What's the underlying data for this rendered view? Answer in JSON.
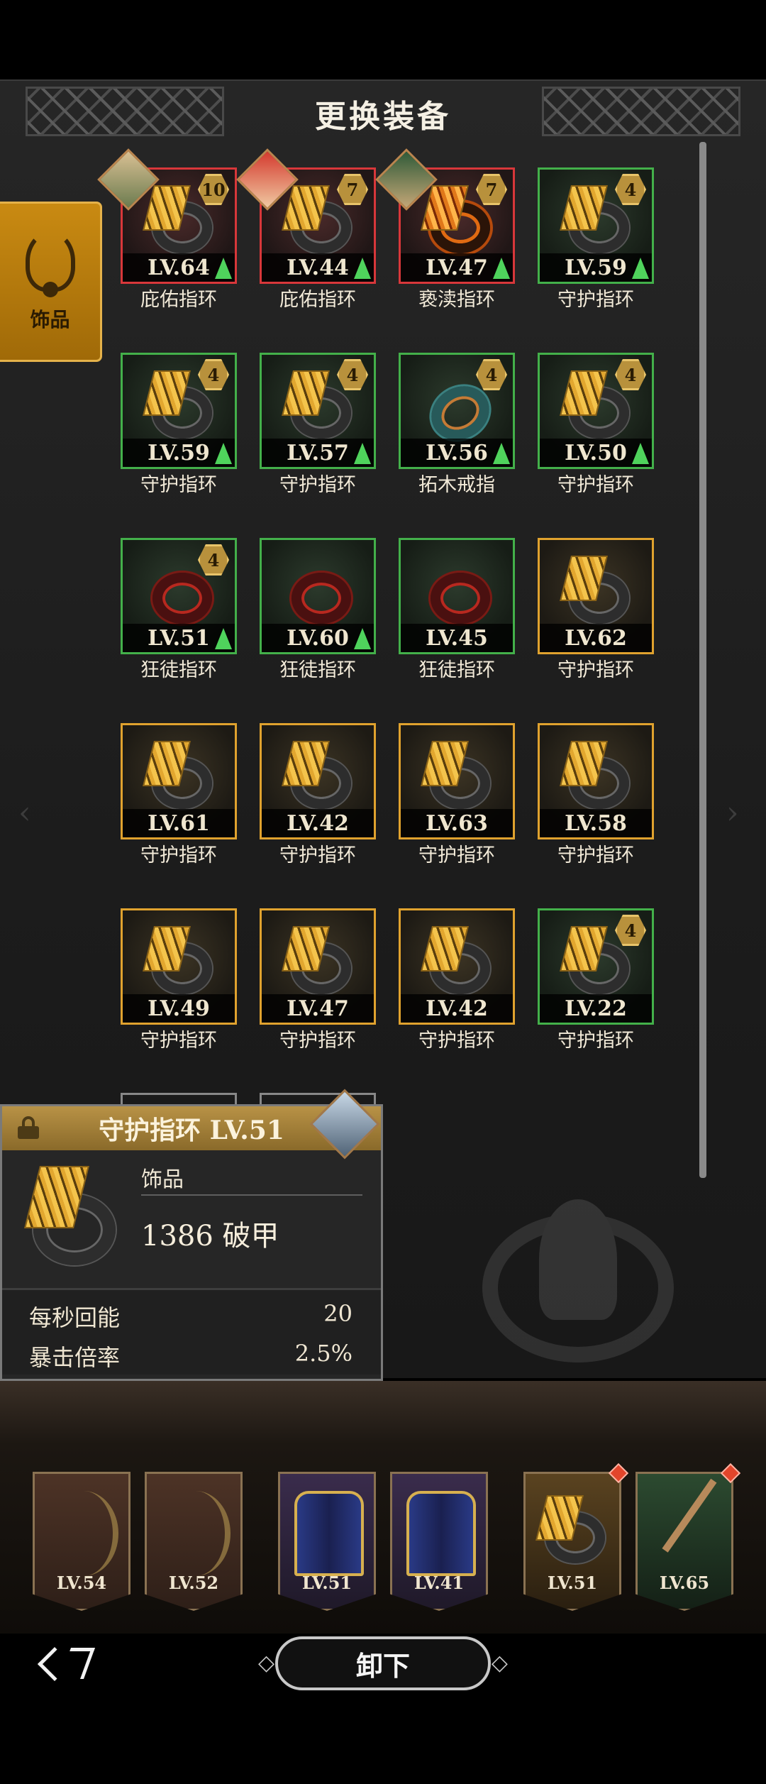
{
  "header": {
    "title": "更换装备"
  },
  "side_tab": {
    "label": "饰品"
  },
  "items": [
    {
      "level": "LV.64",
      "name": "庇佑指环",
      "rarity": "red",
      "badge": "10",
      "up": true,
      "avatar": "a1",
      "ring": "gold"
    },
    {
      "level": "LV.44",
      "name": "庇佑指环",
      "rarity": "red",
      "badge": "7",
      "up": true,
      "avatar": "a2",
      "ring": "gold"
    },
    {
      "level": "LV.47",
      "name": "亵渎指环",
      "rarity": "red",
      "badge": "7",
      "up": true,
      "avatar": "a3",
      "ring": "fire"
    },
    {
      "level": "LV.59",
      "name": "守护指环",
      "rarity": "green",
      "badge": "4",
      "up": true,
      "avatar": null,
      "ring": "gold"
    },
    {
      "level": "LV.59",
      "name": "守护指环",
      "rarity": "green",
      "badge": "4",
      "up": true,
      "avatar": null,
      "ring": "gold"
    },
    {
      "level": "LV.57",
      "name": "守护指环",
      "rarity": "green",
      "badge": "4",
      "up": true,
      "avatar": null,
      "ring": "gold"
    },
    {
      "level": "LV.56",
      "name": "拓木戒指",
      "rarity": "green",
      "badge": "4",
      "up": true,
      "avatar": null,
      "ring": "teal"
    },
    {
      "level": "LV.50",
      "name": "守护指环",
      "rarity": "green",
      "badge": "4",
      "up": true,
      "avatar": null,
      "ring": "gold"
    },
    {
      "level": "LV.51",
      "name": "狂徒指环",
      "rarity": "green",
      "badge": "4",
      "up": true,
      "avatar": null,
      "ring": "red"
    },
    {
      "level": "LV.60",
      "name": "狂徒指环",
      "rarity": "green",
      "badge": null,
      "up": true,
      "avatar": null,
      "ring": "red"
    },
    {
      "level": "LV.45",
      "name": "狂徒指环",
      "rarity": "green",
      "badge": null,
      "up": false,
      "avatar": null,
      "ring": "red"
    },
    {
      "level": "LV.62",
      "name": "守护指环",
      "rarity": "gold",
      "badge": null,
      "up": false,
      "avatar": null,
      "ring": "gold"
    },
    {
      "level": "LV.61",
      "name": "守护指环",
      "rarity": "gold",
      "badge": null,
      "up": false,
      "avatar": null,
      "ring": "gold"
    },
    {
      "level": "LV.42",
      "name": "守护指环",
      "rarity": "gold",
      "badge": null,
      "up": false,
      "avatar": null,
      "ring": "gold"
    },
    {
      "level": "LV.63",
      "name": "守护指环",
      "rarity": "gold",
      "badge": null,
      "up": false,
      "avatar": null,
      "ring": "gold"
    },
    {
      "level": "LV.58",
      "name": "守护指环",
      "rarity": "gold",
      "badge": null,
      "up": false,
      "avatar": null,
      "ring": "gold"
    },
    {
      "level": "LV.49",
      "name": "守护指环",
      "rarity": "gold",
      "badge": null,
      "up": false,
      "avatar": null,
      "ring": "gold"
    },
    {
      "level": "LV.47",
      "name": "守护指环",
      "rarity": "gold",
      "badge": null,
      "up": false,
      "avatar": null,
      "ring": "gold"
    },
    {
      "level": "LV.42",
      "name": "守护指环",
      "rarity": "gold",
      "badge": null,
      "up": false,
      "avatar": null,
      "ring": "gold"
    },
    {
      "level": "LV.22",
      "name": "守护指环",
      "rarity": "green",
      "badge": "4",
      "up": false,
      "avatar": null,
      "ring": "gold"
    }
  ],
  "tooltip": {
    "title": "守护指环 LV.51",
    "category": "饰品",
    "main_value": "1386",
    "main_unit": "破甲",
    "stats": [
      {
        "label": "每秒回能",
        "value": "20"
      },
      {
        "label": "暴击倍率",
        "value": "2.5%"
      }
    ]
  },
  "equipped": [
    {
      "level": "LV.54",
      "style": "bronze",
      "art": "bow",
      "alert": false
    },
    {
      "level": "LV.52",
      "style": "bronze",
      "art": "bow",
      "alert": false
    },
    {
      "level": "LV.51",
      "style": "purple",
      "art": "cape",
      "alert": false
    },
    {
      "level": "LV.41",
      "style": "purple",
      "art": "cape",
      "alert": false
    },
    {
      "level": "LV.51",
      "style": "gold",
      "art": "ring",
      "alert": true
    },
    {
      "level": "LV.65",
      "style": "green",
      "art": "spear",
      "alert": true
    }
  ],
  "footer": {
    "unequip_label": "卸下"
  },
  "colors": {
    "red_rarity": "#d8373a",
    "green_rarity": "#43b04a",
    "gold_rarity": "#e0a22e",
    "tab_gold": "#c98a12"
  }
}
